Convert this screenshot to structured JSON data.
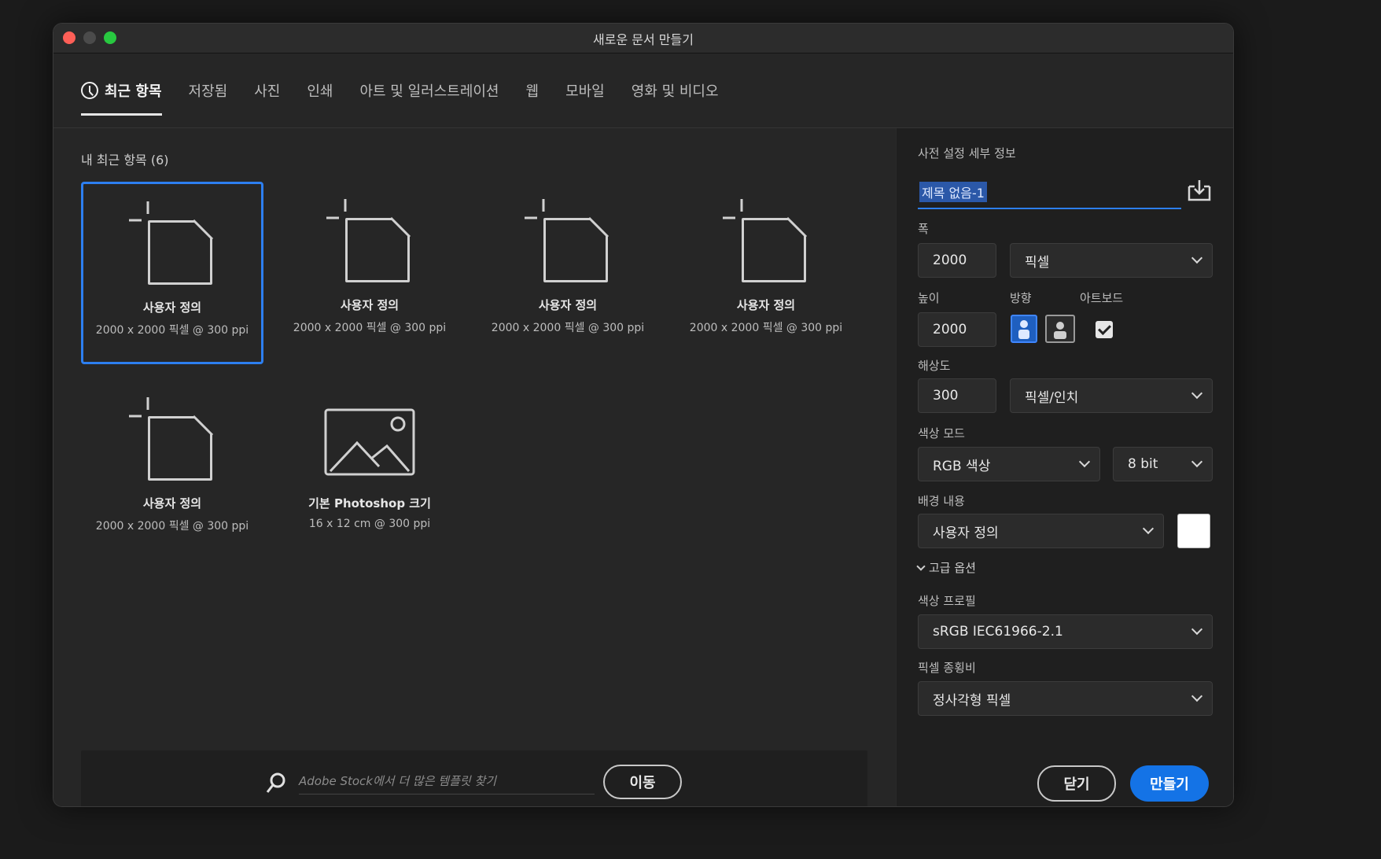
{
  "window": {
    "title": "새로운 문서 만들기"
  },
  "tabs": [
    {
      "label": "최근 항목",
      "active": true
    },
    {
      "label": "저장됨"
    },
    {
      "label": "사진"
    },
    {
      "label": "인쇄"
    },
    {
      "label": "아트 및 일러스트레이션"
    },
    {
      "label": "웹"
    },
    {
      "label": "모바일"
    },
    {
      "label": "영화 및 비디오"
    }
  ],
  "recent": {
    "title": "내 최근 항목 (6)",
    "items": [
      {
        "name": "사용자 정의",
        "detail": "2000 x 2000 픽셀 @ 300 ppi",
        "icon": "blank-document-icon",
        "selected": true
      },
      {
        "name": "사용자 정의",
        "detail": "2000 x 2000 픽셀 @ 300 ppi",
        "icon": "blank-document-icon"
      },
      {
        "name": "사용자 정의",
        "detail": "2000 x 2000 픽셀 @ 300 ppi",
        "icon": "blank-document-icon"
      },
      {
        "name": "사용자 정의",
        "detail": "2000 x 2000 픽셀 @ 300 ppi",
        "icon": "blank-document-icon"
      },
      {
        "name": "사용자 정의",
        "detail": "2000 x 2000 픽셀 @ 300 ppi",
        "icon": "blank-document-icon"
      },
      {
        "name": "기본 Photoshop 크기",
        "detail": "16 x 12 cm @ 300 ppi",
        "icon": "image-icon"
      }
    ]
  },
  "search": {
    "placeholder": "Adobe Stock에서 더 많은 템플릿 찾기",
    "go_label": "이동"
  },
  "details": {
    "header": "사전 설정 세부 정보",
    "doc_name": "제목 없음-1",
    "width_label": "폭",
    "width_value": "2000",
    "width_unit": "픽셀",
    "height_label": "높이",
    "height_value": "2000",
    "orientation_label": "방향",
    "artboard_label": "아트보드",
    "artboard_checked": true,
    "resolution_label": "해상도",
    "resolution_value": "300",
    "resolution_unit": "픽셀/인치",
    "color_mode_label": "색상 모드",
    "color_mode": "RGB 색상",
    "bit_depth": "8 bit",
    "background_label": "배경 내용",
    "background": "사용자 정의",
    "background_color": "#ffffff",
    "advanced_label": "고급 옵션",
    "color_profile_label": "색상 프로필",
    "color_profile": "sRGB IEC61966-2.1",
    "pixel_aspect_label": "픽셀 종횡비",
    "pixel_aspect": "정사각형 픽셀"
  },
  "buttons": {
    "close": "닫기",
    "create": "만들기"
  },
  "colors": {
    "accent": "#1473e6",
    "selection": "#2d7ff0"
  }
}
